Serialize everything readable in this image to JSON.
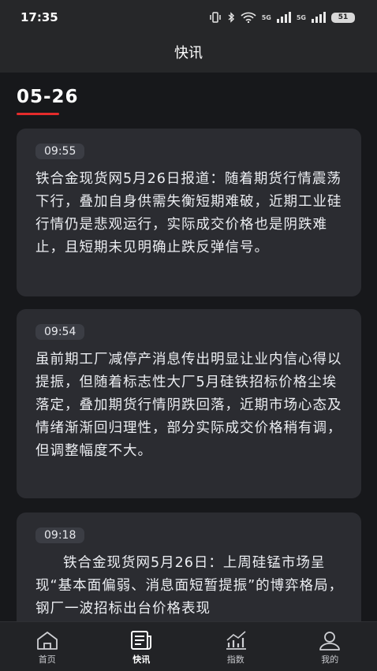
{
  "status_bar": {
    "time": "17:35",
    "battery": "51",
    "network_a": "5G",
    "network_b": "5G"
  },
  "header": {
    "title": "快讯"
  },
  "feed": {
    "date": "05-26",
    "items": [
      {
        "time": "09:55",
        "text": "铁合金现货网5月26日报道：随着期货行情震荡下行，叠加自身供需失衡短期难破，近期工业硅行情仍是悲观运行，实际成交价格也是阴跌难止，且短期未见明确止跌反弹信号。"
      },
      {
        "time": "09:54",
        "text": "虽前期工厂减停产消息传出明显让业内信心得以提振，但随着标志性大厂5月硅铁招标价格尘埃落定，叠加期货行情阴跌回落，近期市场心态及情绪渐渐回归理性，部分实际成交价格稍有调，但调整幅度不大。"
      },
      {
        "time": "09:18",
        "text": "铁合金现货网5月26日：上周硅锰市场呈现“基本面偏弱、消息面短暂提振”的博弈格局，钢厂一波招标出台价格表现"
      }
    ]
  },
  "tab_bar": {
    "items": [
      {
        "label": "首页",
        "icon": "home-icon"
      },
      {
        "label": "快讯",
        "icon": "news-icon"
      },
      {
        "label": "指数",
        "icon": "chart-icon"
      },
      {
        "label": "我的",
        "icon": "user-icon"
      }
    ],
    "active": "快讯"
  }
}
